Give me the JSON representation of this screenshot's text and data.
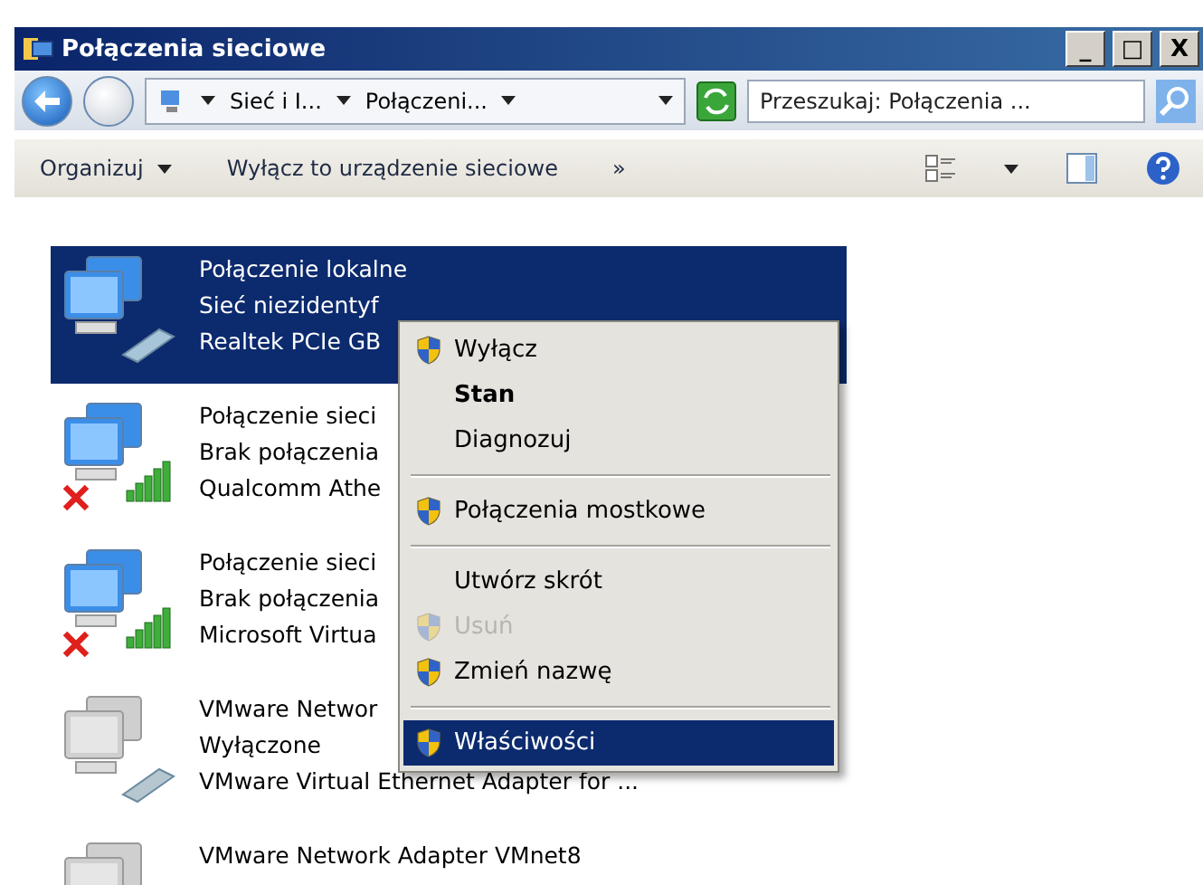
{
  "window": {
    "title": "Połączenia sieciowe",
    "controls": [
      "_",
      "□",
      "X"
    ]
  },
  "address": {
    "crumbs": [
      "Sieć i I...",
      "Połączeni..."
    ],
    "search_placeholder": "Przeszukaj: Połączenia ..."
  },
  "toolbar": {
    "items": [
      {
        "label": "Organizuj",
        "dropdown": true
      },
      {
        "label": "Wyłącz to urządzenie sieciowe",
        "dropdown": false
      }
    ],
    "more": "»"
  },
  "adapters": [
    {
      "kind": "wired",
      "selected": true,
      "disabled": false,
      "disconnected": false,
      "lines": [
        "Połączenie lokalne",
        "Sieć niezidentyf",
        "Realtek PCIe GB"
      ]
    },
    {
      "kind": "wireless",
      "selected": false,
      "disabled": false,
      "disconnected": true,
      "lines": [
        "Połączenie sieci",
        "Brak połączenia",
        "Qualcomm Athe"
      ]
    },
    {
      "kind": "wireless",
      "selected": false,
      "disabled": false,
      "disconnected": true,
      "lines": [
        "Połączenie sieci",
        "Brak połączenia",
        "Microsoft Virtua"
      ]
    },
    {
      "kind": "wired",
      "selected": false,
      "disabled": true,
      "disconnected": false,
      "lines": [
        "VMware Networ",
        "Wyłączone",
        "VMware Virtual Ethernet Adapter for ..."
      ]
    },
    {
      "kind": "wired",
      "selected": false,
      "disabled": true,
      "disconnected": false,
      "lines": [
        "VMware Network Adapter VMnet8"
      ]
    }
  ],
  "context_menu": [
    {
      "kind": "item",
      "label": "Wyłącz",
      "shield": true,
      "bold": false,
      "disabled": false,
      "selected": false
    },
    {
      "kind": "item",
      "label": "Stan",
      "shield": false,
      "bold": true,
      "disabled": false,
      "selected": false
    },
    {
      "kind": "item",
      "label": "Diagnozuj",
      "shield": false,
      "bold": false,
      "disabled": false,
      "selected": false
    },
    {
      "kind": "separator"
    },
    {
      "kind": "item",
      "label": "Połączenia mostkowe",
      "shield": true,
      "bold": false,
      "disabled": false,
      "selected": false
    },
    {
      "kind": "separator"
    },
    {
      "kind": "item",
      "label": "Utwórz skrót",
      "shield": false,
      "bold": false,
      "disabled": false,
      "selected": false
    },
    {
      "kind": "item",
      "label": "Usuń",
      "shield": true,
      "bold": false,
      "disabled": true,
      "selected": false
    },
    {
      "kind": "item",
      "label": "Zmień nazwę",
      "shield": true,
      "bold": false,
      "disabled": false,
      "selected": false
    },
    {
      "kind": "separator"
    },
    {
      "kind": "item",
      "label": "Właściwości",
      "shield": true,
      "bold": false,
      "disabled": false,
      "selected": true
    }
  ]
}
